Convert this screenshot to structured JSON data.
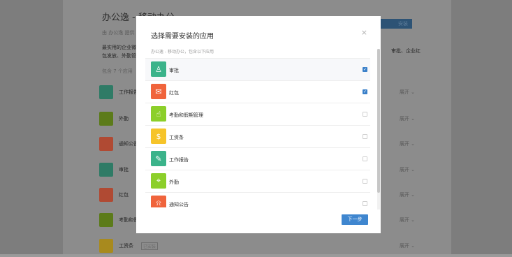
{
  "background": {
    "title": "办公逸 - 移动办公",
    "breadcrumb": "由 办公逸 提供",
    "description_line1": "最实用的企业微",
    "description_line2": "包发放、外勤管",
    "description_right": "审批、企业红",
    "count_label": "包含 7 个应用",
    "install_label": "安装",
    "apps": [
      {
        "name": "工作报告",
        "expand": "展开 ⌄",
        "color": "#2f7b66"
      },
      {
        "name": "外勤",
        "expand": "展开 ⌄",
        "color": "#5c7b1a"
      },
      {
        "name": "通知公告",
        "expand": "展开 ⌄",
        "color": "#b04a33"
      },
      {
        "name": "审批",
        "expand": "展开 ⌄",
        "color": "#2f7b66"
      },
      {
        "name": "红包",
        "expand": "展开 ⌄",
        "color": "#b04a33"
      },
      {
        "name": "考勤和假期管理",
        "expand": "展开 ⌄",
        "color": "#5c7b1a"
      },
      {
        "name": "工资条",
        "tag": "已安装",
        "expand": "展开 ⌄",
        "color": "#a88a1e"
      }
    ]
  },
  "modal": {
    "title": "选择需要安装的应用",
    "close_glyph": "×",
    "subtitle": "办公逸 - 移动办公，包含以下应用",
    "next_label": "下一步",
    "items": [
      {
        "label": "审批",
        "checked": true,
        "color": "#3bb38a",
        "icon": "stamp-icon",
        "glyph": "♙"
      },
      {
        "label": "红包",
        "checked": true,
        "color": "#f0643c",
        "icon": "red-envelope-icon",
        "glyph": "✉"
      },
      {
        "label": "考勤和假期管理",
        "checked": false,
        "color": "#8ccf2a",
        "icon": "hand-touch-icon",
        "glyph": "☝"
      },
      {
        "label": "工资条",
        "checked": false,
        "color": "#f6c42a",
        "icon": "salary-icon",
        "glyph": "$"
      },
      {
        "label": "工作报告",
        "checked": false,
        "color": "#3bb38a",
        "icon": "report-edit-icon",
        "glyph": "✎"
      },
      {
        "label": "外勤",
        "checked": false,
        "color": "#8ccf2a",
        "icon": "location-pin-icon",
        "glyph": "⌖"
      },
      {
        "label": "通知公告",
        "checked": false,
        "color": "#f0643c",
        "icon": "bell-icon",
        "glyph": "⍾"
      }
    ]
  }
}
